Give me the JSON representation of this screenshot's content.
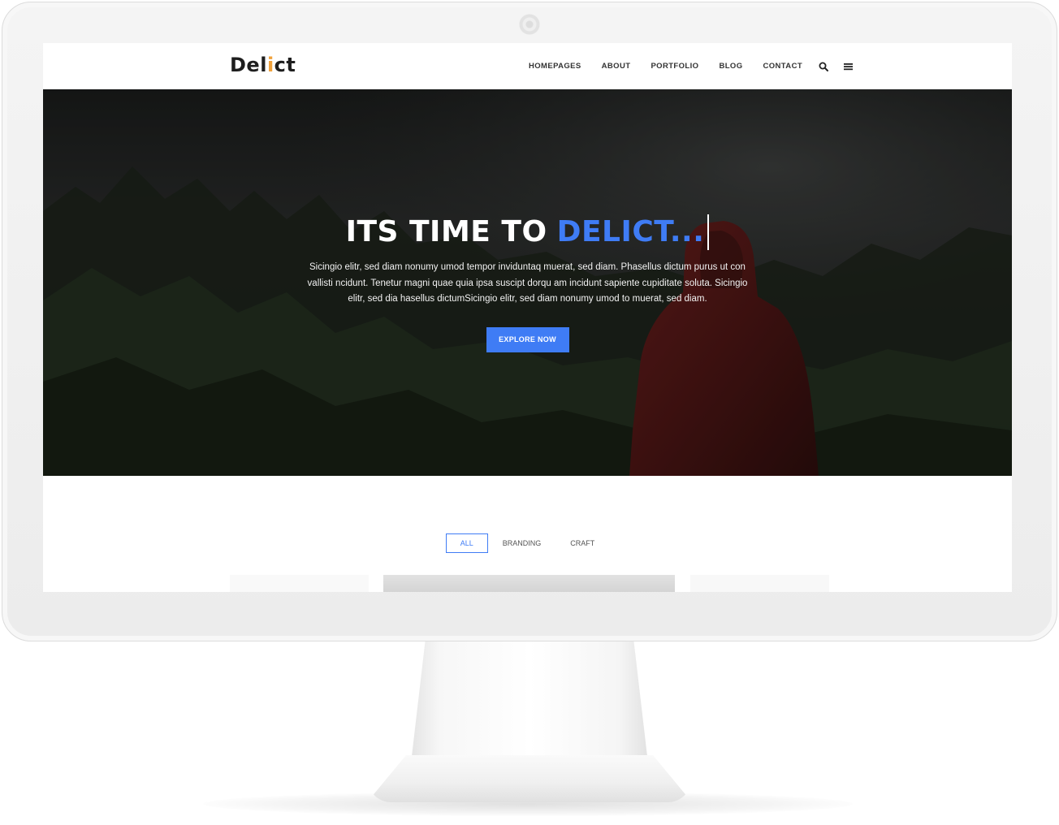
{
  "brand": {
    "logo_start": "Del",
    "logo_accent": "i",
    "logo_end": "ct",
    "accent_color": "#f0a13b"
  },
  "nav": {
    "items": [
      {
        "label": "HOMEPAGES"
      },
      {
        "label": "ABOUT"
      },
      {
        "label": "PORTFOLIO"
      },
      {
        "label": "BLOG"
      },
      {
        "label": "CONTACT"
      }
    ],
    "icons": [
      "search-icon",
      "menu-icon"
    ]
  },
  "hero": {
    "title_plain": "ITS TIME TO",
    "title_highlight": "DELICT...",
    "text": "Sicingio elitr, sed diam nonumy umod tempor inviduntaq muerat, sed diam. Phasellus dictum purus ut con vallisti ncidunt. Tenetur magni quae quia ipsa suscipt dorqu am incidunt sapiente cupiditate soluta. Sicingio elitr, sed dia hasellus dictumSicingio elitr, sed diam nonumy umod to muerat, sed diam.",
    "button_label": "EXPLORE NOW",
    "highlight_color": "#3f7cf5"
  },
  "filters": {
    "items": [
      {
        "label": "ALL",
        "active": true
      },
      {
        "label": "BRANDING",
        "active": false
      },
      {
        "label": "CRAFT",
        "active": false
      }
    ]
  }
}
